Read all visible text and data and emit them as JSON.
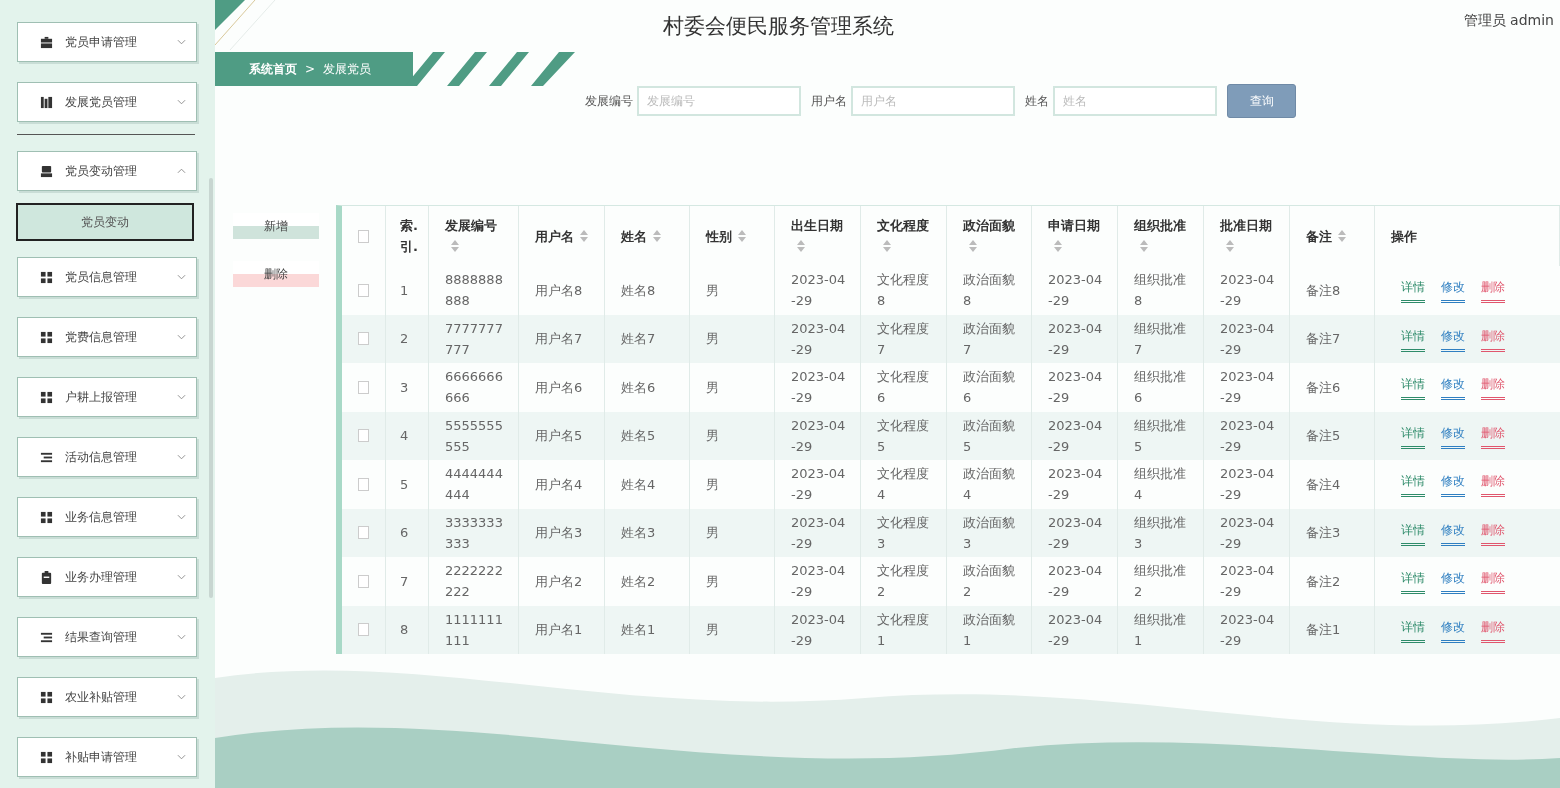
{
  "header": {
    "title": "村委会便民服务管理系统",
    "user": "管理员 admin"
  },
  "sidebar": {
    "items": [
      {
        "label": "党员申请管理",
        "kind": "briefcase",
        "expanded": false
      },
      {
        "label": "发展党员管理",
        "kind": "bars",
        "expanded": false
      },
      {
        "label": "党员变动管理",
        "kind": "tray",
        "expanded": true,
        "children": [
          {
            "label": "党员变动",
            "selected": true
          }
        ]
      },
      {
        "label": "党员信息管理",
        "kind": "grid",
        "expanded": false
      },
      {
        "label": "党费信息管理",
        "kind": "grid",
        "expanded": false
      },
      {
        "label": "户耕上报管理",
        "kind": "grid",
        "expanded": false
      },
      {
        "label": "活动信息管理",
        "kind": "list",
        "expanded": false
      },
      {
        "label": "业务信息管理",
        "kind": "grid",
        "expanded": false
      },
      {
        "label": "业务办理管理",
        "kind": "clipboard",
        "expanded": false
      },
      {
        "label": "结果查询管理",
        "kind": "list",
        "expanded": false
      },
      {
        "label": "农业补贴管理",
        "kind": "grid",
        "expanded": false
      },
      {
        "label": "补贴申请管理",
        "kind": "grid",
        "expanded": false
      }
    ]
  },
  "breadcrumb": [
    "系统首页",
    "发展党员"
  ],
  "breadcrumb_separator": ">",
  "search": {
    "fields": [
      {
        "label": "发展编号",
        "placeholder": "发展编号"
      },
      {
        "label": "用户名",
        "placeholder": "用户名"
      },
      {
        "label": "姓名",
        "placeholder": "姓名"
      }
    ],
    "button": "查询"
  },
  "actions": [
    {
      "label": "新增",
      "kind": "add"
    },
    {
      "label": "删除",
      "kind": "delete"
    }
  ],
  "table": {
    "select_all_checked": false,
    "columns": [
      {
        "label": "索.引.",
        "sortable": false
      },
      {
        "label": "发展编号",
        "sortable": true
      },
      {
        "label": "用户名",
        "sortable": true
      },
      {
        "label": "姓名",
        "sortable": true
      },
      {
        "label": "性别",
        "sortable": true
      },
      {
        "label": "出生日期",
        "sortable": true
      },
      {
        "label": "文化程度",
        "sortable": true
      },
      {
        "label": "政治面貌",
        "sortable": true
      },
      {
        "label": "申请日期",
        "sortable": true
      },
      {
        "label": "组织批准",
        "sortable": true
      },
      {
        "label": "批准日期",
        "sortable": true
      },
      {
        "label": "备注",
        "sortable": true
      },
      {
        "label": "操作",
        "sortable": false
      }
    ],
    "rows": [
      {
        "checked": false,
        "cells": [
          "1",
          "8888888888",
          "用户名8",
          "姓名8",
          "男",
          "2023-04-29",
          "文化程度8",
          "政治面貌8",
          "2023-04-29",
          "组织批准8",
          "2023-04-29",
          "备注8"
        ],
        "actions": [
          {
            "label": "详情",
            "kind": "detail"
          },
          {
            "label": "修改",
            "kind": "edit"
          },
          {
            "label": "删除",
            "kind": "delete"
          }
        ]
      },
      {
        "checked": false,
        "cells": [
          "2",
          "7777777777",
          "用户名7",
          "姓名7",
          "男",
          "2023-04-29",
          "文化程度7",
          "政治面貌7",
          "2023-04-29",
          "组织批准7",
          "2023-04-29",
          "备注7"
        ],
        "actions": [
          {
            "label": "详情",
            "kind": "detail"
          },
          {
            "label": "修改",
            "kind": "edit"
          },
          {
            "label": "删除",
            "kind": "delete"
          }
        ]
      },
      {
        "checked": false,
        "cells": [
          "3",
          "6666666666",
          "用户名6",
          "姓名6",
          "男",
          "2023-04-29",
          "文化程度6",
          "政治面貌6",
          "2023-04-29",
          "组织批准6",
          "2023-04-29",
          "备注6"
        ],
        "actions": [
          {
            "label": "详情",
            "kind": "detail"
          },
          {
            "label": "修改",
            "kind": "edit"
          },
          {
            "label": "删除",
            "kind": "delete"
          }
        ]
      },
      {
        "checked": false,
        "cells": [
          "4",
          "5555555555",
          "用户名5",
          "姓名5",
          "男",
          "2023-04-29",
          "文化程度5",
          "政治面貌5",
          "2023-04-29",
          "组织批准5",
          "2023-04-29",
          "备注5"
        ],
        "actions": [
          {
            "label": "详情",
            "kind": "detail"
          },
          {
            "label": "修改",
            "kind": "edit"
          },
          {
            "label": "删除",
            "kind": "delete"
          }
        ]
      },
      {
        "checked": false,
        "cells": [
          "5",
          "4444444444",
          "用户名4",
          "姓名4",
          "男",
          "2023-04-29",
          "文化程度4",
          "政治面貌4",
          "2023-04-29",
          "组织批准4",
          "2023-04-29",
          "备注4"
        ],
        "actions": [
          {
            "label": "详情",
            "kind": "detail"
          },
          {
            "label": "修改",
            "kind": "edit"
          },
          {
            "label": "删除",
            "kind": "delete"
          }
        ]
      },
      {
        "checked": false,
        "cells": [
          "6",
          "3333333333",
          "用户名3",
          "姓名3",
          "男",
          "2023-04-29",
          "文化程度3",
          "政治面貌3",
          "2023-04-29",
          "组织批准3",
          "2023-04-29",
          "备注3"
        ],
        "actions": [
          {
            "label": "详情",
            "kind": "detail"
          },
          {
            "label": "修改",
            "kind": "edit"
          },
          {
            "label": "删除",
            "kind": "delete"
          }
        ]
      },
      {
        "checked": false,
        "cells": [
          "7",
          "2222222222",
          "用户名2",
          "姓名2",
          "男",
          "2023-04-29",
          "文化程度2",
          "政治面貌2",
          "2023-04-29",
          "组织批准2",
          "2023-04-29",
          "备注2"
        ],
        "actions": [
          {
            "label": "详情",
            "kind": "detail"
          },
          {
            "label": "修改",
            "kind": "edit"
          },
          {
            "label": "删除",
            "kind": "delete"
          }
        ]
      },
      {
        "checked": false,
        "cells": [
          "8",
          "1111111111",
          "用户名1",
          "姓名1",
          "男",
          "2023-04-29",
          "文化程度1",
          "政治面貌1",
          "2023-04-29",
          "组织批准1",
          "2023-04-29",
          "备注1"
        ],
        "actions": [
          {
            "label": "详情",
            "kind": "detail"
          },
          {
            "label": "修改",
            "kind": "edit"
          },
          {
            "label": "删除",
            "kind": "delete"
          }
        ]
      }
    ]
  }
}
